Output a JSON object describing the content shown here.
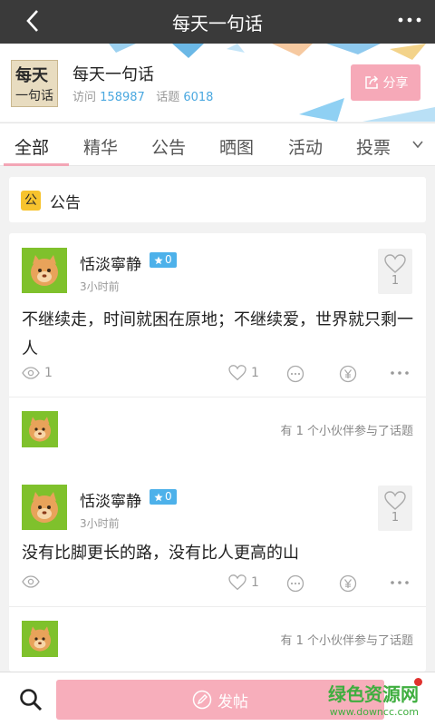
{
  "topbar": {
    "title": "每天一句话"
  },
  "group": {
    "logo_top": "每天",
    "logo_bottom": "一句话",
    "name": "每天一句话",
    "visits_label": "访问",
    "visits": "158987",
    "topics_label": "话题",
    "topics": "6018",
    "share_label": "分享"
  },
  "tabs": [
    "全部",
    "精华",
    "公告",
    "晒图",
    "活动",
    "投票"
  ],
  "notice": {
    "badge": "公",
    "label": "公告"
  },
  "posts": [
    {
      "author": "恬淡寧静",
      "level": "0",
      "time": "3小时前",
      "likes": "1",
      "content": "不继续走，时间就困在原地；不继续爱，世界就只剩一人",
      "views": "1",
      "action_likes": "1",
      "participants_text": "有 1 个小伙伴参与了话题"
    },
    {
      "author": "恬淡寧静",
      "level": "0",
      "time": "3小时前",
      "likes": "1",
      "content": "没有比脚更长的路，没有比人更高的山",
      "views": "",
      "action_likes": "1",
      "participants_text": "有 1 个小伙伴参与了话题"
    }
  ],
  "bottombar": {
    "post_label": "发帖"
  },
  "watermark": {
    "line1": "绿色资源网",
    "line2": "www.downcc.com"
  },
  "colors": {
    "accent_pink": "#f6a9b8",
    "level_blue": "#4db1ea",
    "stat_blue": "#4aa8e0",
    "topbar": "#3a3a3a"
  }
}
